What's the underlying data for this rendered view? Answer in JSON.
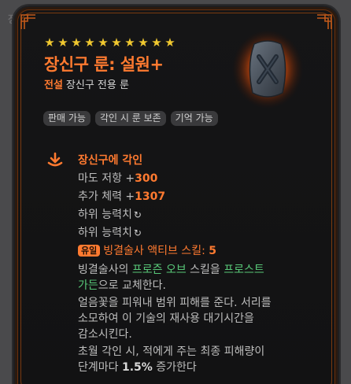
{
  "background_label": "장",
  "item": {
    "stars_count": 10,
    "star_glyph": "★",
    "name": "장신구 룬: 설원+",
    "grade": "전설",
    "type": "장신구 전용 룬",
    "rune_icon": "frost-rune-icon",
    "tags": [
      "판매 가능",
      "각인 시 룬 보존",
      "기억 가능"
    ]
  },
  "engrave": {
    "title": "장신구에 각인",
    "stats": [
      {
        "label": "마도 저항 +",
        "value": "300"
      },
      {
        "label": "추가 체력 +",
        "value": "1307"
      }
    ],
    "rerolls": [
      {
        "label": "하위 능력치",
        "icon": "↻"
      },
      {
        "label": "하위 능력치",
        "icon": "↻"
      }
    ],
    "unique_badge": "유일",
    "unique_text": "빙결술사 액티브 스킬: ",
    "unique_value": "5",
    "desc1_a": "빙결술사의 ",
    "desc1_b": "프로즌 오브",
    "desc1_c": " 스킬을 ",
    "desc1_d": "프로스트",
    "desc1_e": "가든",
    "desc1_f": "으로 교체한다.",
    "desc2_l1": "얼음꽃을 피워내 범위 피해를 준다. 서리를",
    "desc2_l2": "소모하여 이 기술의 재사용 대기시간을",
    "desc2_l3": "감소시킨다.",
    "desc3_l1": "초월 각인 시, 적에게 주는 최종 피해량이",
    "desc3_a": "단계마다 ",
    "desc3_num": "1.5%",
    "desc3_b": " 증가한다"
  },
  "colors": {
    "accent": "#ff7a30",
    "star": "#f0c830",
    "skill_green": "#58c878"
  }
}
